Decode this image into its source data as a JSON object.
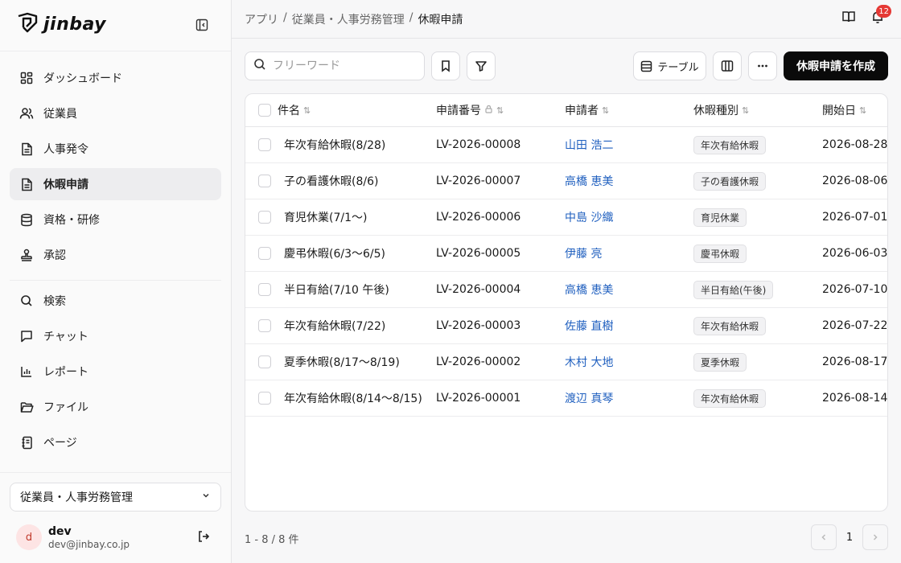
{
  "app": {
    "logo_text": "jinbay"
  },
  "sidebar": {
    "nav_primary": [
      {
        "label": "ダッシュボード",
        "icon": "dashboard-icon"
      },
      {
        "label": "従業員",
        "icon": "users-icon"
      },
      {
        "label": "人事発令",
        "icon": "document-icon"
      },
      {
        "label": "休暇申請",
        "icon": "document-icon",
        "active": true
      },
      {
        "label": "資格・研修",
        "icon": "database-icon"
      },
      {
        "label": "承認",
        "icon": "stamp-icon"
      }
    ],
    "nav_secondary": [
      {
        "label": "検索",
        "icon": "search-icon"
      },
      {
        "label": "チャット",
        "icon": "chat-icon"
      },
      {
        "label": "レポート",
        "icon": "chart-icon"
      },
      {
        "label": "ファイル",
        "icon": "folder-icon"
      },
      {
        "label": "ページ",
        "icon": "notebook-icon"
      }
    ],
    "app_select": "従業員・人事労務管理",
    "user": {
      "initial": "d",
      "name": "dev",
      "email": "dev@jinbay.co.jp"
    }
  },
  "header": {
    "breadcrumbs": [
      "アプリ",
      "従業員・人事労務管理",
      "休暇申請"
    ],
    "separator": "/",
    "notification_count": "12"
  },
  "toolbar": {
    "search_placeholder": "フリーワード",
    "view_label": "テーブル",
    "create_label": "休暇申請を作成"
  },
  "table": {
    "columns": [
      "件名",
      "申請番号",
      "申請者",
      "休暇種別",
      "開始日"
    ],
    "rows": [
      {
        "subject": "年次有給休暇(8/28)",
        "number": "LV-2026-00008",
        "applicant": "山田 浩二",
        "type": "年次有給休暇",
        "start": "2026-08-28"
      },
      {
        "subject": "子の看護休暇(8/6)",
        "number": "LV-2026-00007",
        "applicant": "高橋 恵美",
        "type": "子の看護休暇",
        "start": "2026-08-06"
      },
      {
        "subject": "育児休業(7/1〜)",
        "number": "LV-2026-00006",
        "applicant": "中島 沙織",
        "type": "育児休業",
        "start": "2026-07-01"
      },
      {
        "subject": "慶弔休暇(6/3〜6/5)",
        "number": "LV-2026-00005",
        "applicant": "伊藤 亮",
        "type": "慶弔休暇",
        "start": "2026-06-03"
      },
      {
        "subject": "半日有給(7/10 午後)",
        "number": "LV-2026-00004",
        "applicant": "高橋 恵美",
        "type": "半日有給(午後)",
        "start": "2026-07-10"
      },
      {
        "subject": "年次有給休暇(7/22)",
        "number": "LV-2026-00003",
        "applicant": "佐藤 直樹",
        "type": "年次有給休暇",
        "start": "2026-07-22"
      },
      {
        "subject": "夏季休暇(8/17〜8/19)",
        "number": "LV-2026-00002",
        "applicant": "木村 大地",
        "type": "夏季休暇",
        "start": "2026-08-17"
      },
      {
        "subject": "年次有給休暇(8/14〜8/15)",
        "number": "LV-2026-00001",
        "applicant": "渡辺 真琴",
        "type": "年次有給休暇",
        "start": "2026-08-14"
      }
    ]
  },
  "footer": {
    "count_text": "1 - 8 / 8 件",
    "page": "1"
  }
}
